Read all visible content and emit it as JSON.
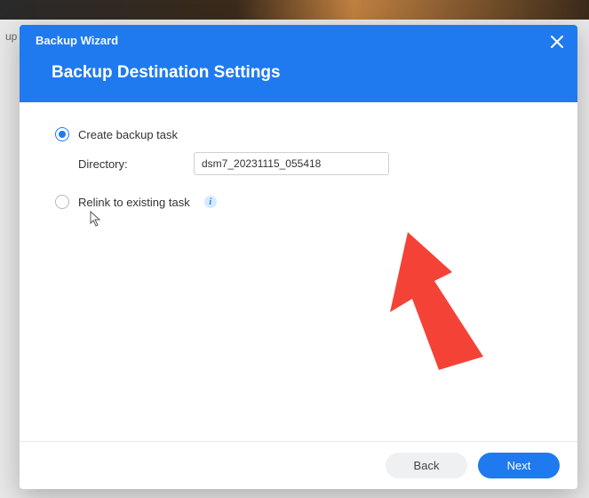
{
  "backdrop": {
    "partial_tab": "up"
  },
  "modal": {
    "title": "Backup Wizard",
    "heading": "Backup Destination Settings"
  },
  "options": {
    "create": {
      "label": "Create backup task",
      "directory_label": "Directory:",
      "directory_value": "dsm7_20231115_055418"
    },
    "relink": {
      "label": "Relink to existing task"
    }
  },
  "footer": {
    "back": "Back",
    "next": "Next"
  }
}
